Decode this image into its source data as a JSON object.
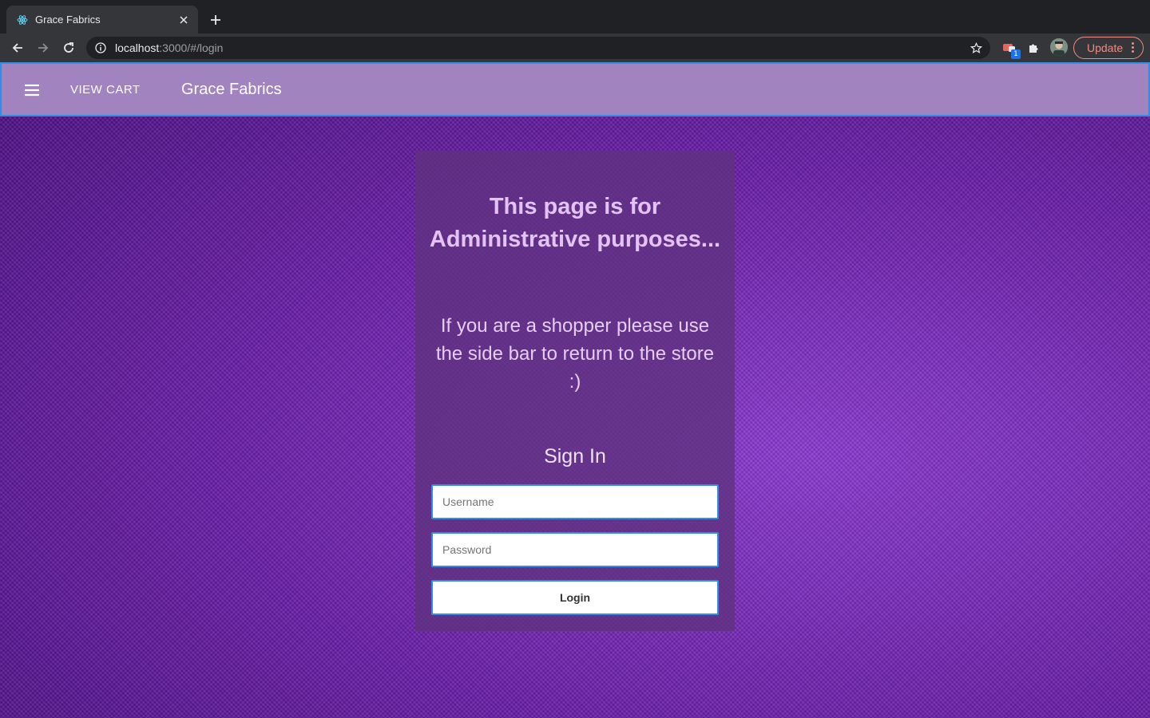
{
  "browser": {
    "tab_title": "Grace Fabrics",
    "url_host": "localhost",
    "url_rest": ":3000/#/login",
    "extension_badge": "1",
    "update_label": "Update"
  },
  "appbar": {
    "view_cart_label": "VIEW CART",
    "brand": "Grace Fabrics"
  },
  "card": {
    "heading": "This page is for Administrative purposes...",
    "subtext": "If you are a shopper please use the side bar to return to the store :)",
    "sign_in_title": "Sign In",
    "username_placeholder": "Username",
    "password_placeholder": "Password",
    "login_label": "Login"
  },
  "colors": {
    "appbar": "#a183bf",
    "focus_border": "#2f8fe0",
    "background": "#6d1ea8",
    "update_accent": "#f28b82"
  }
}
